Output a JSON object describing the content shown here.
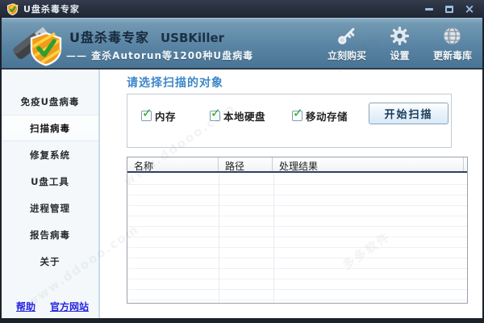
{
  "window": {
    "title": "U盘杀毒专家",
    "close_glyph": "×"
  },
  "header": {
    "title_cn": "U盘杀毒专家",
    "title_en": "USBKiller",
    "subtitle": "—— 查杀Autorun等1200种U盘病毒",
    "buttons": [
      {
        "label": "立刻购买",
        "icon": "key-icon"
      },
      {
        "label": "设置",
        "icon": "gear-icon"
      },
      {
        "label": "更新毒库",
        "icon": "globe-icon"
      }
    ]
  },
  "sidebar": {
    "items": [
      {
        "label": "免疫U盘病毒",
        "selected": false
      },
      {
        "label": "扫描病毒",
        "selected": true
      },
      {
        "label": "修复系统",
        "selected": false
      },
      {
        "label": "U盘工具",
        "selected": false
      },
      {
        "label": "进程管理",
        "selected": false
      },
      {
        "label": "报告病毒",
        "selected": false
      },
      {
        "label": "关于",
        "selected": false
      }
    ],
    "footer_links": [
      {
        "label": "帮助"
      },
      {
        "label": "官方网站"
      }
    ]
  },
  "main": {
    "heading": "请选择扫描的对象",
    "scan_targets": [
      {
        "label": "内存",
        "checked": true
      },
      {
        "label": "本地硬盘",
        "checked": true
      },
      {
        "label": "移动存储",
        "checked": true
      }
    ],
    "start_button": "开始扫描",
    "table": {
      "columns": [
        "名称",
        "路径",
        "处理结果"
      ],
      "rows": []
    }
  },
  "icons": {
    "check_glyph": "✓"
  },
  "colors": {
    "header_blue": "#5a84a3",
    "accent_heading": "#3d87c9",
    "link_blue": "#2525e0",
    "check_green": "#1ca81c",
    "shield_orange": "#ef9b1d"
  },
  "watermark": {
    "text1": "www.ddooo.com",
    "text2": "多多软件"
  }
}
